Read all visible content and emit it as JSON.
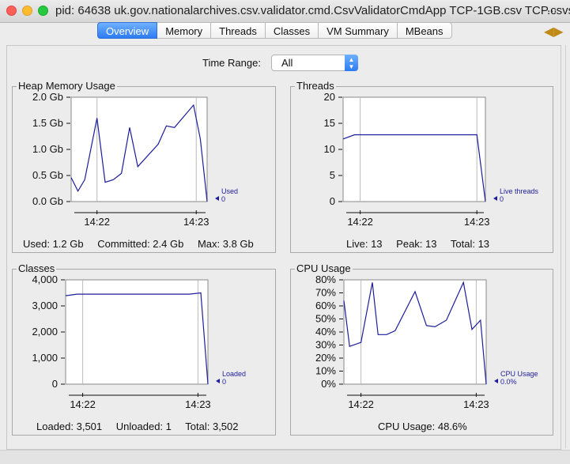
{
  "window": {
    "title": "pid: 64638 uk.gov.nationalarchives.csv.validator.cmd.CsvValidatorCmdApp TCP-1GB.csv TCP.csvs",
    "overflow": "..."
  },
  "tabs": [
    {
      "label": "Overview",
      "active": true
    },
    {
      "label": "Memory",
      "active": false
    },
    {
      "label": "Threads",
      "active": false
    },
    {
      "label": "Classes",
      "active": false
    },
    {
      "label": "VM Summary",
      "active": false
    },
    {
      "label": "MBeans",
      "active": false
    }
  ],
  "time_range": {
    "label": "Time Range:",
    "value": "All"
  },
  "colors": {
    "series": "#1d1d9c",
    "tab_active": "#2c7cf2"
  },
  "charts": {
    "heap": {
      "title": "Heap Memory Usage",
      "legend": {
        "name": "Used",
        "value": "0"
      },
      "stats": [
        "Used: 1.2 Gb",
        "Committed: 2.4 Gb",
        "Max: 3.8 Gb"
      ]
    },
    "threads": {
      "title": "Threads",
      "legend": {
        "name": "Live threads",
        "value": "0"
      },
      "stats": [
        "Live: 13",
        "Peak: 13",
        "Total: 13"
      ]
    },
    "classes": {
      "title": "Classes",
      "legend": {
        "name": "Loaded",
        "value": "0"
      },
      "stats": [
        "Loaded: 3,501",
        "Unloaded: 1",
        "Total: 3,502"
      ]
    },
    "cpu": {
      "title": "CPU Usage",
      "legend": {
        "name": "CPU Usage",
        "value": "0.0%"
      },
      "stats": [
        "CPU Usage: 48.6%"
      ]
    }
  },
  "chart_data": [
    {
      "type": "line",
      "title": "Heap Memory Usage",
      "ylim": [
        0,
        2.0
      ],
      "yticks": [
        0,
        0.5,
        1.0,
        1.5,
        2.0
      ],
      "ytick_labels": [
        "0.0 Gb",
        "0.5 Gb",
        "1.0 Gb",
        "1.5 Gb",
        "2.0 Gb"
      ],
      "xticks": [
        "14:22",
        "14:23"
      ],
      "xlim": [
        0,
        100
      ],
      "xtick_positions": [
        19,
        92
      ],
      "series": [
        {
          "name": "Used",
          "x": [
            0,
            5,
            10,
            19,
            25,
            31,
            37,
            43,
            49,
            64,
            70,
            76,
            90,
            95,
            100
          ],
          "y": [
            0.46,
            0.2,
            0.42,
            1.6,
            0.37,
            0.42,
            0.54,
            1.42,
            0.67,
            1.1,
            1.45,
            1.42,
            1.85,
            1.2,
            0.0
          ]
        }
      ],
      "grid": true
    },
    {
      "type": "line",
      "title": "Threads",
      "ylim": [
        0,
        20
      ],
      "yticks": [
        0,
        5,
        10,
        15,
        20
      ],
      "ytick_labels": [
        "0",
        "5",
        "10",
        "15",
        "20"
      ],
      "xticks": [
        "14:22",
        "14:23"
      ],
      "xlim": [
        0,
        100
      ],
      "xtick_positions": [
        12,
        94
      ],
      "series": [
        {
          "name": "Live threads",
          "x": [
            0,
            8,
            94,
            100
          ],
          "y": [
            12,
            12.8,
            12.8,
            0
          ]
        }
      ],
      "grid": true
    },
    {
      "type": "line",
      "title": "Classes",
      "ylim": [
        0,
        4000
      ],
      "yticks": [
        0,
        1000,
        2000,
        3000,
        4000
      ],
      "ytick_labels": [
        "0",
        "1,000",
        "2,000",
        "3,000",
        "4,000"
      ],
      "xticks": [
        "14:22",
        "14:23"
      ],
      "xlim": [
        0,
        100
      ],
      "xtick_positions": [
        12,
        93
      ],
      "series": [
        {
          "name": "Loaded",
          "x": [
            0,
            8,
            87,
            95,
            100
          ],
          "y": [
            3390,
            3450,
            3450,
            3501,
            0
          ]
        }
      ],
      "grid": true
    },
    {
      "type": "line",
      "title": "CPU Usage",
      "ylim": [
        0,
        80
      ],
      "yticks": [
        0,
        10,
        20,
        30,
        40,
        50,
        60,
        70,
        80
      ],
      "ytick_labels": [
        "0%",
        "10%",
        "20%",
        "30%",
        "40%",
        "50%",
        "60%",
        "70%",
        "80%"
      ],
      "xticks": [
        "14:22",
        "14:23"
      ],
      "xlim": [
        0,
        100
      ],
      "xtick_positions": [
        12,
        93
      ],
      "series": [
        {
          "name": "CPU Usage",
          "x": [
            0,
            4,
            12,
            20,
            24,
            30,
            36,
            50,
            58,
            64,
            72,
            84,
            90,
            96,
            100
          ],
          "y": [
            64,
            29,
            32,
            78,
            38,
            38,
            41,
            71,
            45,
            44,
            49,
            78,
            42,
            49,
            0
          ]
        }
      ],
      "grid": true
    }
  ]
}
